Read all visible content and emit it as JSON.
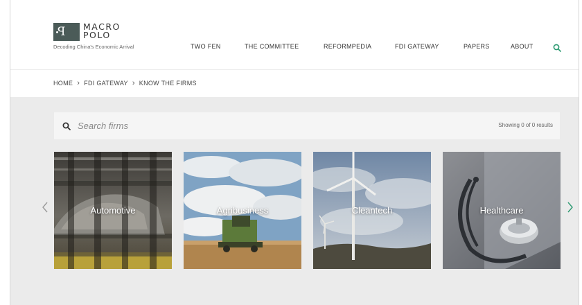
{
  "brand": {
    "name_line1": "MACRO",
    "name_line2": "POLO",
    "tagline": "Decoding China's Economic Arrival"
  },
  "nav": {
    "items": [
      "TWO FEN",
      "THE COMMITTEE",
      "REFORMPEDIA",
      "FDI GATEWAY",
      "PAPERS",
      "ABOUT"
    ],
    "search_icon": "search-icon",
    "accent_color": "#2c9a72"
  },
  "breadcrumb": [
    "HOME",
    "FDI GATEWAY",
    "KNOW THE FIRMS"
  ],
  "search": {
    "placeholder": "Search firms",
    "value": "",
    "results_text": "Showing 0 of 0 results"
  },
  "cards": [
    {
      "label": "Automotive"
    },
    {
      "label": "Agribusiness"
    },
    {
      "label": "Cleantech"
    },
    {
      "label": "Healthcare"
    }
  ]
}
